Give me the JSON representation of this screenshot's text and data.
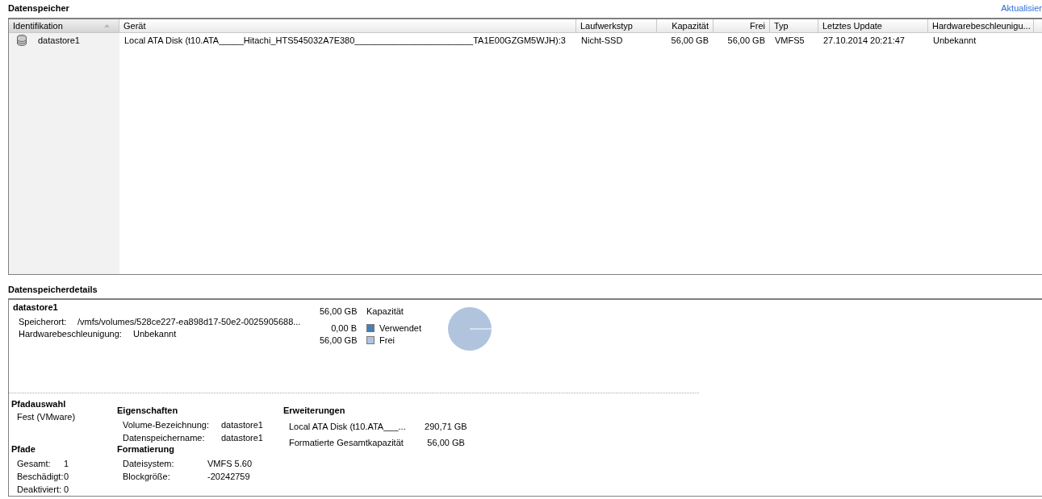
{
  "datastores": {
    "title": "Datenspeicher",
    "refresh_link": "Aktualisier",
    "columns": [
      {
        "label": "Identifikation",
        "sorted": true,
        "kind": "text"
      },
      {
        "label": "Gerät",
        "sorted": false,
        "kind": "text"
      },
      {
        "label": "Laufwerkstyp",
        "sorted": false,
        "kind": "text"
      },
      {
        "label": "Kapazität",
        "sorted": false,
        "kind": "number"
      },
      {
        "label": "Frei",
        "sorted": false,
        "kind": "number"
      },
      {
        "label": "Typ",
        "sorted": false,
        "kind": "text"
      },
      {
        "label": "Letztes Update",
        "sorted": false,
        "kind": "text"
      },
      {
        "label": "Hardwarebeschleunigu...",
        "sorted": false,
        "kind": "text"
      }
    ],
    "rows": [
      {
        "cells": [
          "datastore1",
          "Local ATA Disk (t10.ATA_____Hitachi_HTS545032A7E380________________________TA1E00GZGM5WJH):3",
          "Nicht-SSD",
          "56,00 GB",
          "56,00 GB",
          "VMFS5",
          "27.10.2014 20:21:47",
          "Unbekannt"
        ]
      }
    ]
  },
  "details": {
    "title": "Datenspeicherdetails",
    "name": "datastore1",
    "info": [
      {
        "label": "Speicherort:",
        "value": "/vmfs/volumes/528ce227-ea898d17-50e2-0025905688..."
      },
      {
        "label": "Hardwarebeschleunigung:",
        "value": "Unbekannt"
      }
    ],
    "capacity": {
      "value": "56,00 GB",
      "label": "Kapazität"
    },
    "legend": [
      {
        "value": "0,00 B",
        "label": "Verwendet",
        "color": "#4a7eb5"
      },
      {
        "value": "56,00 GB",
        "label": "Frei",
        "color": "#b0c4de"
      }
    ],
    "path_selection": {
      "title": "Pfadauswahl",
      "value": "Fest (VMware)"
    },
    "paths": {
      "title": "Pfade",
      "rows": [
        {
          "label": "Gesamt:",
          "value": "1"
        },
        {
          "label": "Beschädigt:",
          "value": "0"
        },
        {
          "label": "Deaktiviert:",
          "value": "0"
        }
      ]
    },
    "properties": {
      "title": "Eigenschaften",
      "rows": [
        {
          "label": "Volume-Bezeichnung:",
          "value": "datastore1"
        },
        {
          "label": "Datenspeichername:",
          "value": "datastore1"
        }
      ]
    },
    "formatting": {
      "title": "Formatierung",
      "rows": [
        {
          "label": "Dateisystem:",
          "value": "VMFS 5.60"
        },
        {
          "label": "Blockgröße:",
          "value": "-20242759"
        }
      ]
    },
    "extents": {
      "title": "Erweiterungen",
      "rows": [
        {
          "label": "Local ATA Disk (t10.ATA___...",
          "value": "290,71 GB"
        },
        {
          "label": "Formatierte Gesamtkapazität",
          "value": "56,00 GB"
        }
      ]
    }
  }
}
